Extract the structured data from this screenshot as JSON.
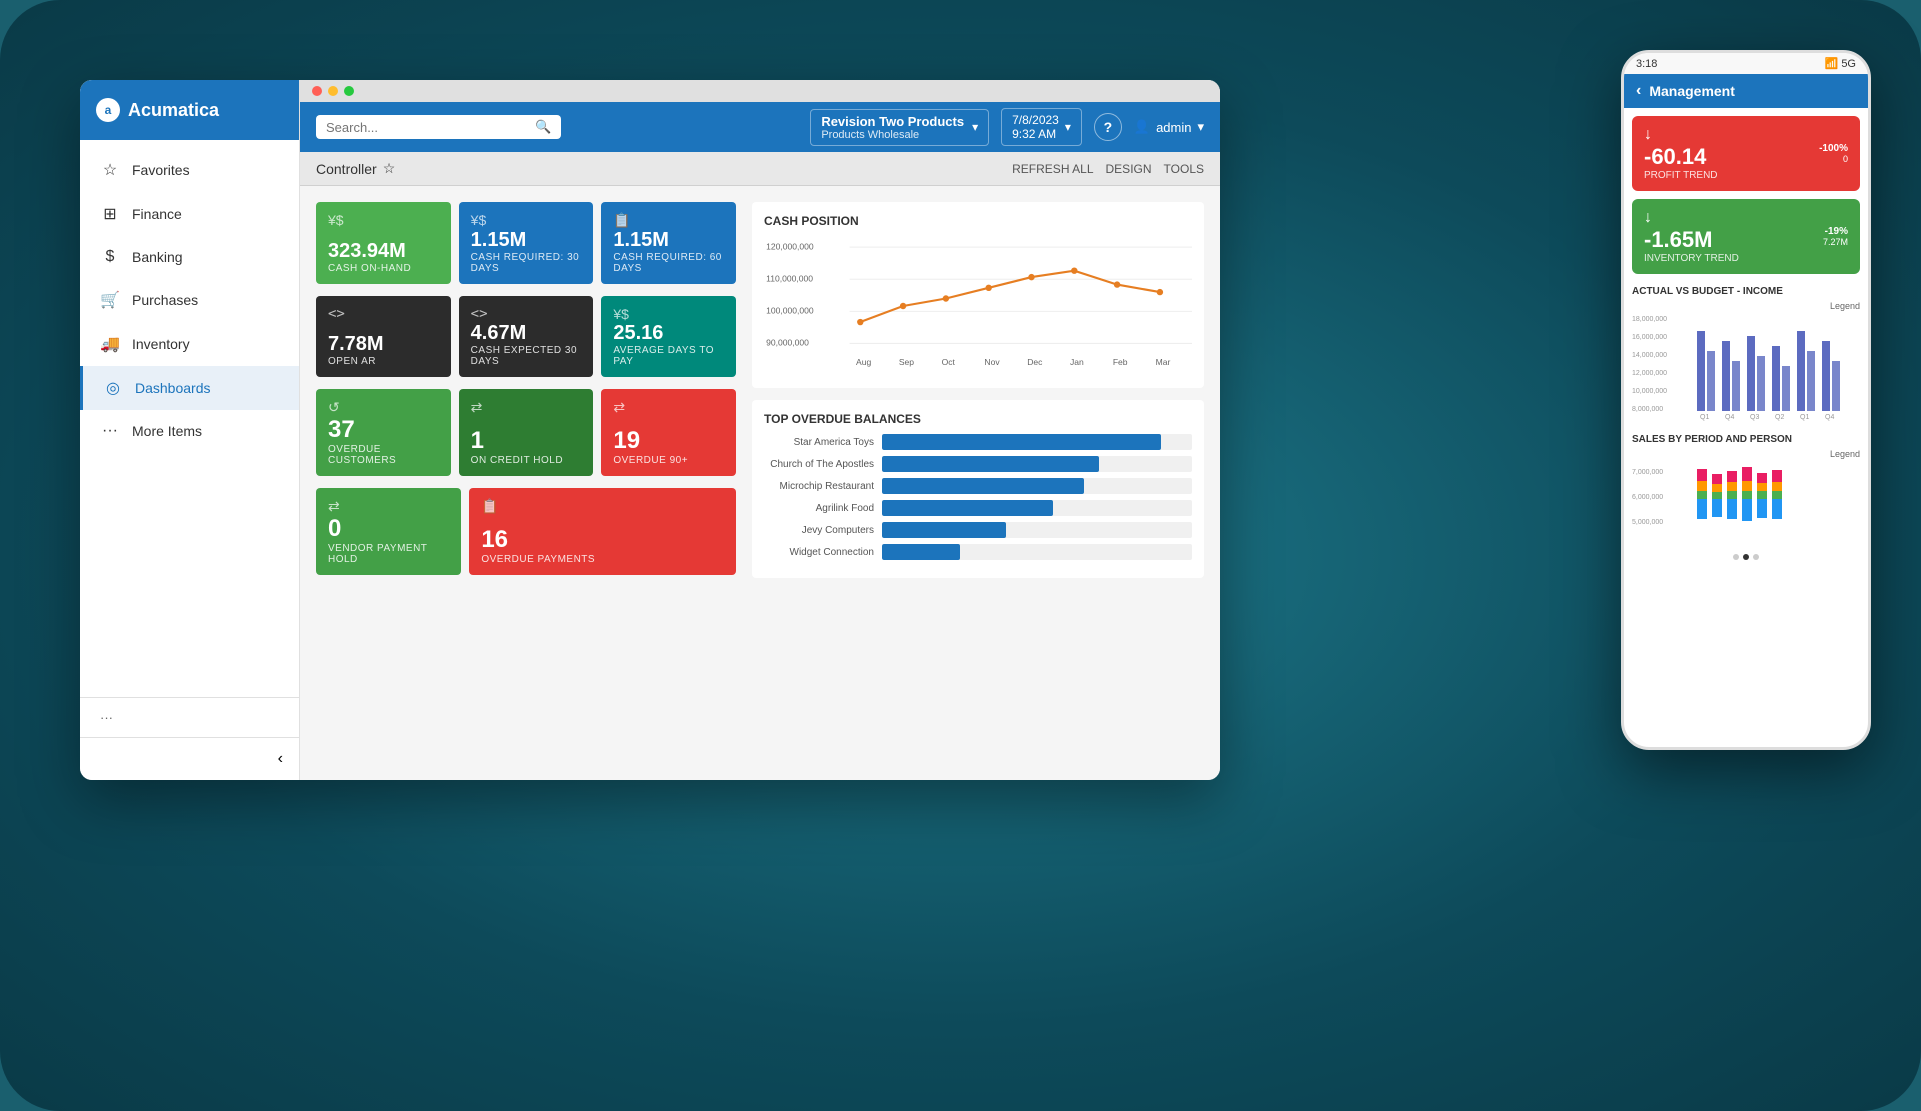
{
  "scene": {
    "bg_color": "#1a5f6e"
  },
  "logo": {
    "text": "Acumatica",
    "icon": "a"
  },
  "sidebar": {
    "items": [
      {
        "id": "favorites",
        "label": "Favorites",
        "icon": "☆",
        "active": false
      },
      {
        "id": "finance",
        "label": "Finance",
        "icon": "⊞",
        "active": false
      },
      {
        "id": "banking",
        "label": "Banking",
        "icon": "$",
        "active": false
      },
      {
        "id": "purchases",
        "label": "Purchases",
        "icon": "🛒",
        "active": false
      },
      {
        "id": "inventory",
        "label": "Inventory",
        "icon": "🚚",
        "active": false
      },
      {
        "id": "dashboards",
        "label": "Dashboards",
        "icon": "◎",
        "active": true
      },
      {
        "id": "more-items",
        "label": "More Items",
        "icon": "⋯",
        "active": false
      }
    ],
    "footer": {
      "dots": "..."
    }
  },
  "topbar": {
    "search_placeholder": "Search...",
    "company_name": "Revision Two Products",
    "company_sub": "Products Wholesale",
    "date": "7/8/2023",
    "time": "9:32 AM",
    "user": "admin",
    "help_label": "?"
  },
  "page_header": {
    "breadcrumb": "Controller",
    "actions": [
      "REFRESH ALL",
      "DESIGN",
      "TOOLS"
    ]
  },
  "kpi_cards": {
    "row1": [
      {
        "id": "cash-on-hand",
        "value": "323.94M",
        "label": "CASH ON-HAND",
        "icon": "¥$",
        "color": "green"
      },
      {
        "id": "cash-required-30",
        "value": "1.15M",
        "label": "CASH REQUIRED: 30 DAYS",
        "icon": "¥$",
        "color": "blue"
      },
      {
        "id": "cash-required-60",
        "value": "1.15M",
        "label": "CASH REQUIRED: 60 DAYS",
        "icon": "📋",
        "color": "blue"
      }
    ],
    "row2": [
      {
        "id": "open-ar",
        "value": "7.78M",
        "label": "OPEN AR",
        "icon": "<>",
        "color": "dark"
      },
      {
        "id": "cash-expected-30",
        "value": "4.67M",
        "label": "CASH EXPECTED 30 DAYS",
        "icon": "<>",
        "color": "dark"
      },
      {
        "id": "avg-days-pay",
        "value": "25.16",
        "label": "AVERAGE DAYS TO PAY",
        "icon": "¥$",
        "color": "teal"
      }
    ]
  },
  "status_cards": {
    "row1": [
      {
        "id": "overdue-customers",
        "value": "37",
        "label": "OVERDUE CUSTOMERS",
        "icon": "↺",
        "color": "green-light"
      },
      {
        "id": "on-credit-hold",
        "value": "1",
        "label": "ON CREDIT HOLD",
        "icon": "⇄",
        "color": "green-dark"
      },
      {
        "id": "overdue-90-plus",
        "value": "19",
        "label": "OVERDUE 90+",
        "icon": "⇄",
        "color": "red"
      }
    ],
    "row2": [
      {
        "id": "vendor-payment-hold",
        "value": "0",
        "label": "VENDOR PAYMENT HOLD",
        "icon": "⇄",
        "color": "green-light"
      },
      {
        "id": "overdue-payments",
        "value": "16",
        "label": "OVERDUE PAYMENTS",
        "icon": "📋",
        "color": "red"
      }
    ]
  },
  "cash_position": {
    "title": "CASH POSITION",
    "months": [
      "Aug",
      "Sep",
      "Oct",
      "Nov",
      "Dec",
      "Jan",
      "Feb",
      "Mar"
    ],
    "y_labels": [
      "120,000,000",
      "110,000,000",
      "100,000,000",
      "90,000,000"
    ],
    "data_points": [
      95,
      100,
      103,
      107,
      110,
      112,
      108,
      105
    ]
  },
  "overdue_balances": {
    "title": "TOP OVERDUE BALANCES",
    "items": [
      {
        "label": "Star America Toys",
        "pct": 90
      },
      {
        "label": "Church of The Apostles",
        "pct": 70
      },
      {
        "label": "Microchip Restaurant",
        "pct": 65
      },
      {
        "label": "Agrilink Food",
        "pct": 55
      },
      {
        "label": "Jevy Computers",
        "pct": 40
      },
      {
        "label": "Widget Connection",
        "pct": 25
      }
    ]
  },
  "mobile": {
    "time": "3:18",
    "signal": "5G",
    "title": "Management",
    "profit_trend": {
      "value": "-60.14",
      "pct": "-100%",
      "sub_pct": "0",
      "label": "PROFIT TREND",
      "color": "red"
    },
    "inventory_trend": {
      "value": "-1.65M",
      "pct": "-19%",
      "sub_pct": "7.27M",
      "label": "INVENTORY TREND",
      "color": "green"
    },
    "actual_vs_budget": {
      "title": "ACTUAL VS BUDGET - INCOME",
      "legend": "Legend",
      "y_max": "18,000,000",
      "y_labels": [
        "18,000,000",
        "16,000,000",
        "14,000,000",
        "12,000,000",
        "10,000,000",
        "8,000,000"
      ],
      "quarters": [
        "Q1",
        "Q4",
        "Q3",
        "Q2",
        "Q1",
        "Q4"
      ]
    },
    "sales_by_period": {
      "title": "SALES BY PERIOD AND PERSON",
      "legend": "Legend",
      "y_labels": [
        "7,000,000",
        "6,000,000",
        "5,000,000"
      ]
    }
  }
}
